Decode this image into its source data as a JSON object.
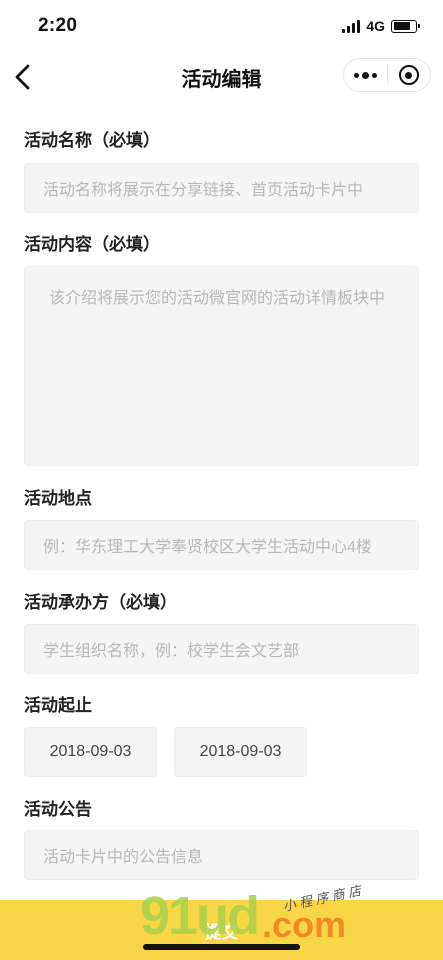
{
  "status_bar": {
    "time": "2:20",
    "network": "4G"
  },
  "nav": {
    "title": "活动编辑"
  },
  "form": {
    "name": {
      "label": "活动名称（必填）",
      "placeholder": "活动名称将展示在分享链接、首页活动卡片中"
    },
    "content": {
      "label": "活动内容（必填）",
      "placeholder": "该介绍将展示您的活动微官网的活动详情板块中"
    },
    "location": {
      "label": "活动地点",
      "placeholder": "例：华东理工大学奉贤校区大学生活动中心4楼"
    },
    "organizer": {
      "label": "活动承办方（必填）",
      "placeholder": "学生组织名称，例：校学生会文艺部"
    },
    "period": {
      "label": "活动起止",
      "start": "2018-09-03",
      "end": "2018-09-03"
    },
    "notice": {
      "label": "活动公告",
      "placeholder": "活动卡片中的公告信息"
    }
  },
  "submit": {
    "label": "提交"
  },
  "watermark": {
    "main": "91ud",
    "tag": "小 程 序 商 店",
    "suffix": ".com"
  },
  "colors": {
    "submit_bg": "#f9d648",
    "field_bg": "#f5f5f5",
    "placeholder": "#b8b8b8"
  }
}
